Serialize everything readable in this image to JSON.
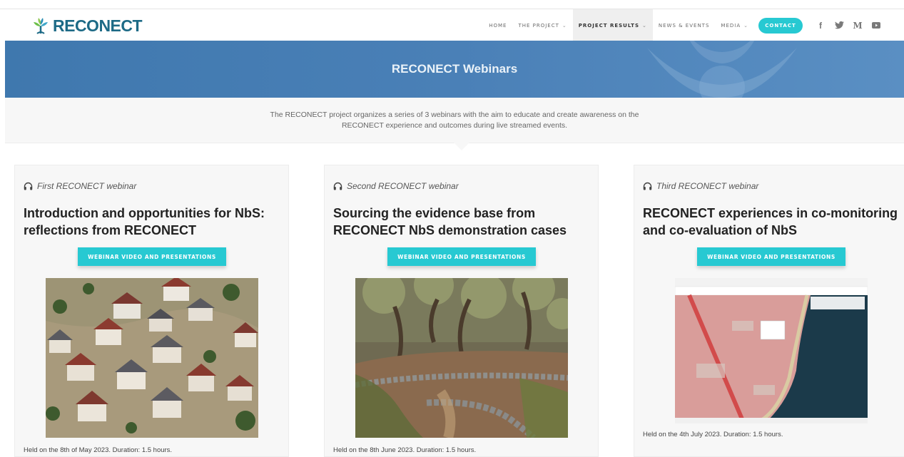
{
  "brand": {
    "name": "RECONECT"
  },
  "nav": {
    "items": [
      {
        "label": "HOME",
        "dropdown": false
      },
      {
        "label": "THE PROJECT",
        "dropdown": true
      },
      {
        "label": "PROJECT RESULTS",
        "dropdown": true,
        "active": true
      },
      {
        "label": "NEWS & EVENTS",
        "dropdown": false
      },
      {
        "label": "MEDIA",
        "dropdown": true
      }
    ],
    "contact_label": "CONTACT",
    "social_icons": [
      "facebook-icon",
      "twitter-icon",
      "medium-icon",
      "youtube-icon"
    ]
  },
  "hero": {
    "title": "RECONECT Webinars"
  },
  "intro": {
    "text": "The RECONECT project organizes a series of 3 webinars with the aim to educate and create awareness on the RECONECT experience and outcomes during live streamed events."
  },
  "colors": {
    "accent": "#27c9d2",
    "brand": "#1d6a86",
    "hero": "#4a80b7"
  },
  "cards": [
    {
      "subtitle": "First RECONECT webinar",
      "title": "Introduction and opportunities for NbS: reflections from RECONECT",
      "button": "WEBINAR VIDEO AND PRESENTATIONS",
      "image": "flooded-town-photo",
      "footer": "Held on the 8th of May 2023. Duration: 1.5 hours."
    },
    {
      "subtitle": "Second RECONECT webinar",
      "title": "Sourcing the evidence base from RECONECT NbS demonstration cases",
      "button": "WEBINAR VIDEO AND PRESENTATIONS",
      "image": "olive-grove-terraces-photo",
      "footer": "Held on the 8th June 2023. Duration: 1.5 hours."
    },
    {
      "subtitle": "Third RECONECT webinar",
      "title": "RECONECT experiences in co-monitoring and co-evaluation of NbS",
      "button": "WEBINAR VIDEO AND PRESENTATIONS",
      "image": "coastal-map-screenshot",
      "footer": "Held on the 4th July 2023. Duration: 1.5 hours."
    }
  ]
}
